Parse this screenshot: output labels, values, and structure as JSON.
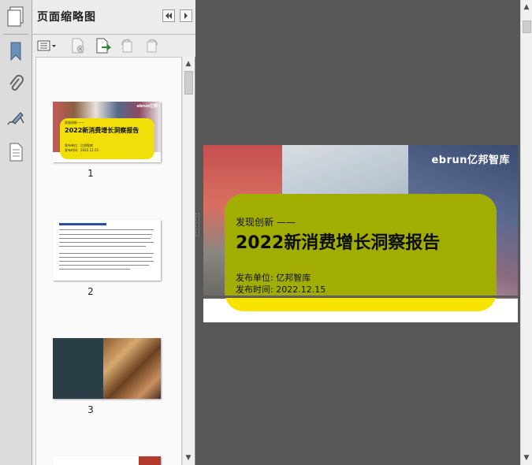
{
  "panel": {
    "title": "页面缩略图"
  },
  "thumbnails": [
    {
      "page_label": "1",
      "subtitle": "发现创新 ——",
      "title": "2022新消费增长洞察报告",
      "meta1": "发布单位：亿邦智库",
      "meta2": "发布时间：2022.12.15",
      "logo": "ebrun亿邦"
    },
    {
      "page_label": "2"
    },
    {
      "page_label": "3"
    },
    {
      "page_label": ""
    }
  ],
  "page": {
    "logo": "ebrun亿邦智库",
    "subtitle": "发现创新 ——",
    "title": "2022新消费增长洞察报告",
    "publisher_label": "发布单位:",
    "publisher_value": "亿邦智库",
    "date_label": "发布时间:",
    "date_value": "2022.12.15"
  },
  "colors": {
    "card_olive": "#a1ad00",
    "card_yellow": "#f7e200",
    "workspace": "#575757"
  }
}
